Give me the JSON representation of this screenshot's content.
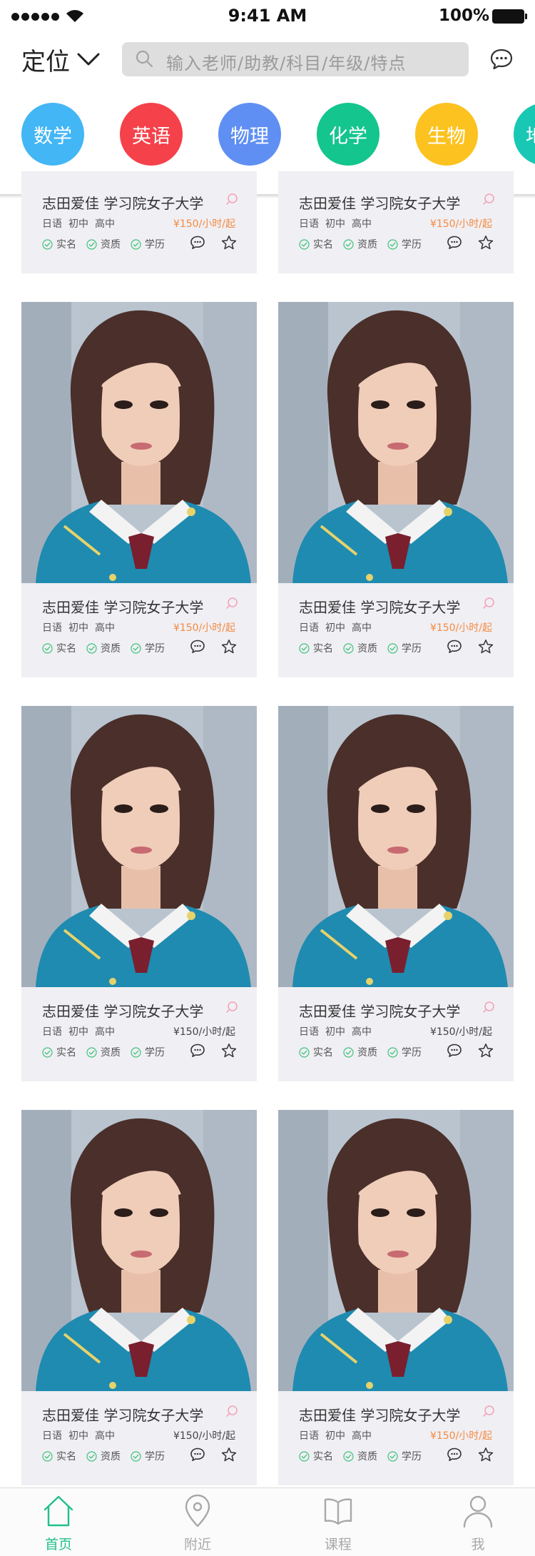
{
  "status_bar": {
    "time": "9:41 AM",
    "battery": "100%"
  },
  "header": {
    "location_label": "定位",
    "search_placeholder": "输入老师/助教/科目/年级/特点"
  },
  "subjects": [
    {
      "label": "数学",
      "color": "#43b6f5"
    },
    {
      "label": "英语",
      "color": "#f4414a"
    },
    {
      "label": "物理",
      "color": "#5f8ff3"
    },
    {
      "label": "化学",
      "color": "#14c58d"
    },
    {
      "label": "生物",
      "color": "#fcc21f"
    },
    {
      "label": "地理",
      "color": "#19c8b4"
    }
  ],
  "cards": [
    {
      "name": "志田爱佳 学习院女子大学",
      "levels": [
        "日语",
        "初中",
        "高中"
      ],
      "price": "¥150/小时/起",
      "price_color": "#f58a3f",
      "badges": [
        "实名",
        "资质",
        "学历"
      ]
    },
    {
      "name": "志田爱佳 学习院女子大学",
      "levels": [
        "日语",
        "初中",
        "高中"
      ],
      "price": "¥150/小时/起",
      "price_color": "#f58a3f",
      "badges": [
        "实名",
        "资质",
        "学历"
      ]
    },
    {
      "name": "志田爱佳 学习院女子大学",
      "levels": [
        "日语",
        "初中",
        "高中"
      ],
      "price": "¥150/小时/起",
      "price_color": "#f58a3f",
      "badges": [
        "实名",
        "资质",
        "学历"
      ]
    },
    {
      "name": "志田爱佳 学习院女子大学",
      "levels": [
        "日语",
        "初中",
        "高中"
      ],
      "price": "¥150/小时/起",
      "price_color": "#f58a3f",
      "badges": [
        "实名",
        "资质",
        "学历"
      ]
    },
    {
      "name": "志田爱佳 学习院女子大学",
      "levels": [
        "日语",
        "初中",
        "高中"
      ],
      "price": "¥150/小时/起",
      "price_color": "#444444",
      "badges": [
        "实名",
        "资质",
        "学历"
      ]
    },
    {
      "name": "志田爱佳 学习院女子大学",
      "levels": [
        "日语",
        "初中",
        "高中"
      ],
      "price": "¥150/小时/起",
      "price_color": "#444444",
      "badges": [
        "实名",
        "资质",
        "学历"
      ]
    },
    {
      "name": "志田爱佳 学习院女子大学",
      "levels": [
        "日语",
        "初中",
        "高中"
      ],
      "price": "¥150/小时/起",
      "price_color": "#444444",
      "badges": [
        "实名",
        "资质",
        "学历"
      ]
    },
    {
      "name": "志田爱佳 学习院女子大学",
      "levels": [
        "日语",
        "初中",
        "高中"
      ],
      "price": "¥150/小时/起",
      "price_color": "#f58a3f",
      "badges": [
        "实名",
        "资质",
        "学历"
      ]
    }
  ],
  "tabs": [
    {
      "label": "首页",
      "icon": "home-icon",
      "active": true
    },
    {
      "label": "附近",
      "icon": "location-pin-icon",
      "active": false
    },
    {
      "label": "课程",
      "icon": "book-icon",
      "active": false
    },
    {
      "label": "我",
      "icon": "person-icon",
      "active": false
    }
  ],
  "colors": {
    "accent": "#21c08b",
    "inactive": "#a8a8a8",
    "badge_check": "#3fc37a",
    "pin": "#f4a0b4"
  }
}
